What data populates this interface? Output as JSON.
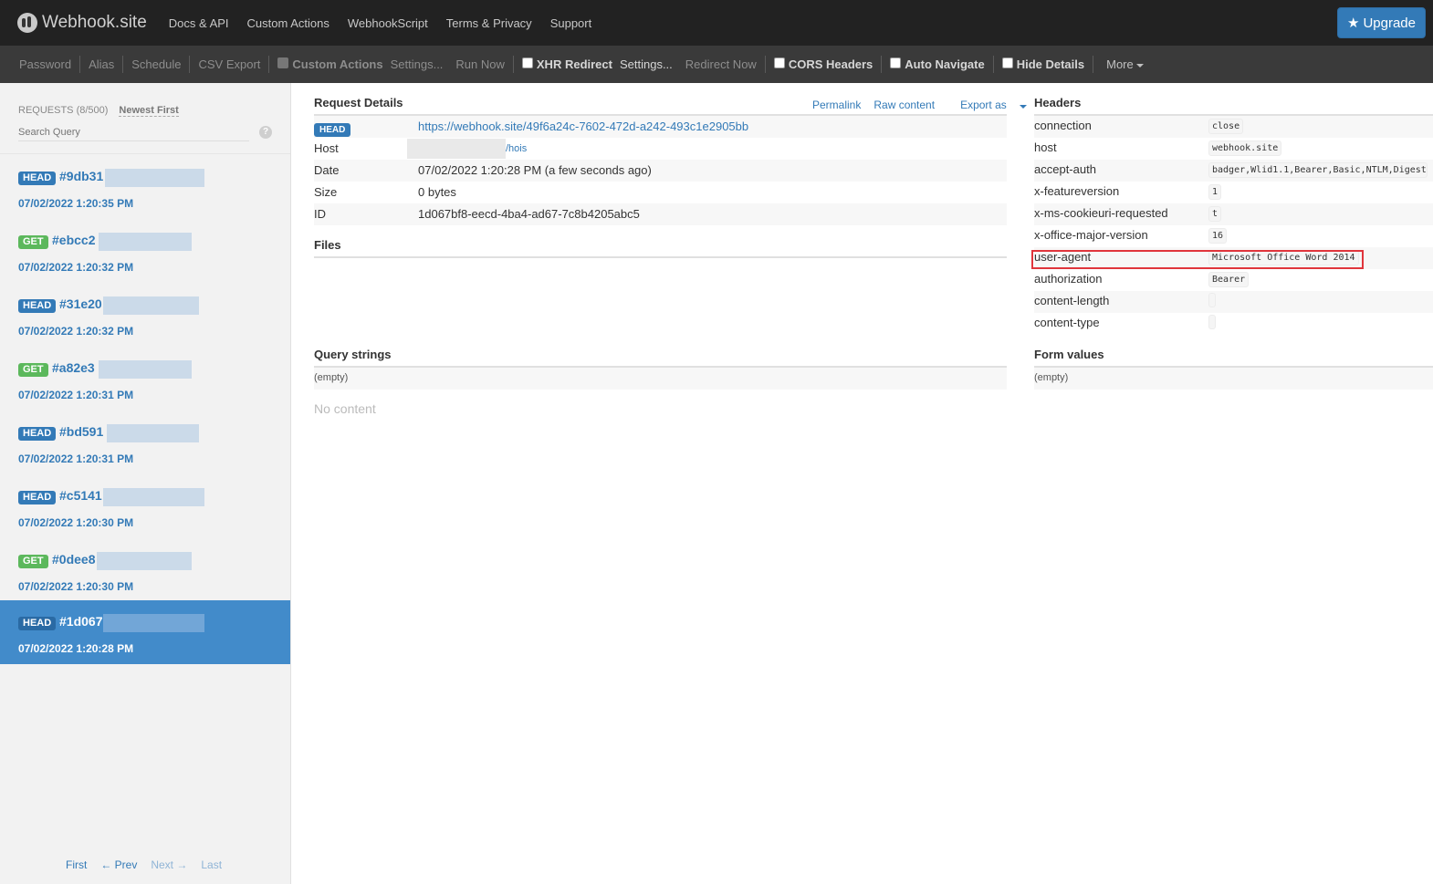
{
  "brand": {
    "name": "Webhook.site"
  },
  "nav": [
    "Docs & API",
    "Custom Actions",
    "WebhookScript",
    "Terms & Privacy",
    "Support"
  ],
  "upgrade_label": "Upgrade",
  "toolbar": {
    "password": "Password",
    "alias": "Alias",
    "schedule": "Schedule",
    "csv_export": "CSV Export",
    "custom_actions": "Custom Actions",
    "custom_settings": "Settings...",
    "run_now": "Run Now",
    "xhr_redirect": "XHR Redirect",
    "xhr_settings": "Settings...",
    "redirect_now": "Redirect Now",
    "cors_headers": "CORS Headers",
    "auto_navigate": "Auto Navigate",
    "hide_details": "Hide Details",
    "more": "More"
  },
  "sidebar": {
    "requests_label": "REQUESTS (8/500)",
    "order_label": "Newest First",
    "search_placeholder": "Search Query",
    "requests": [
      {
        "method": "HEAD",
        "id": "#9db31",
        "time": "07/02/2022 1:20:35 PM"
      },
      {
        "method": "GET",
        "id": "#ebcc2",
        "time": "07/02/2022 1:20:32 PM"
      },
      {
        "method": "HEAD",
        "id": "#31e20",
        "time": "07/02/2022 1:20:32 PM"
      },
      {
        "method": "GET",
        "id": "#a82e3",
        "time": "07/02/2022 1:20:31 PM"
      },
      {
        "method": "HEAD",
        "id": "#bd591",
        "time": "07/02/2022 1:20:31 PM"
      },
      {
        "method": "HEAD",
        "id": "#c5141",
        "time": "07/02/2022 1:20:30 PM"
      },
      {
        "method": "GET",
        "id": "#0dee8",
        "time": "07/02/2022 1:20:30 PM"
      },
      {
        "method": "HEAD",
        "id": "#1d067",
        "time": "07/02/2022 1:20:28 PM"
      }
    ],
    "pager": {
      "first": "First",
      "prev": "← Prev",
      "next": "Next →",
      "last": "Last"
    }
  },
  "details": {
    "title": "Request Details",
    "permalink": "Permalink",
    "raw_content": "Raw content",
    "export_as": "Export as",
    "method": "HEAD",
    "url": "https://webhook.site/49f6a24c-7602-472d-a242-493c1e2905bb",
    "host_label": "Host",
    "host_suffix": "/hois",
    "date_label": "Date",
    "date_value": "07/02/2022 1:20:28 PM (a few seconds ago)",
    "size_label": "Size",
    "size_value": "0 bytes",
    "id_label": "ID",
    "id_value": "1d067bf8-eecd-4ba4-ad67-7c8b4205abc5",
    "files_title": "Files",
    "query_title": "Query strings",
    "query_empty": "(empty)",
    "no_content": "No content"
  },
  "headers": {
    "title": "Headers",
    "rows": [
      {
        "key": "connection",
        "value": "close"
      },
      {
        "key": "host",
        "value": "webhook.site"
      },
      {
        "key": "accept-auth",
        "value": "badger,Wlid1.1,Bearer,Basic,NTLM,Digest"
      },
      {
        "key": "x-featureversion",
        "value": "1"
      },
      {
        "key": "x-ms-cookieuri-requested",
        "value": "t"
      },
      {
        "key": "x-office-major-version",
        "value": "16"
      },
      {
        "key": "user-agent",
        "value": "Microsoft Office Word 2014"
      },
      {
        "key": "authorization",
        "value": "Bearer"
      },
      {
        "key": "content-length",
        "value": ""
      },
      {
        "key": "content-type",
        "value": ""
      }
    ],
    "form_title": "Form values",
    "form_empty": "(empty)"
  },
  "colors": {
    "accent": "#337ab7",
    "get": "#5cb85c",
    "active": "#428bca",
    "highlight": "#e0353c"
  }
}
